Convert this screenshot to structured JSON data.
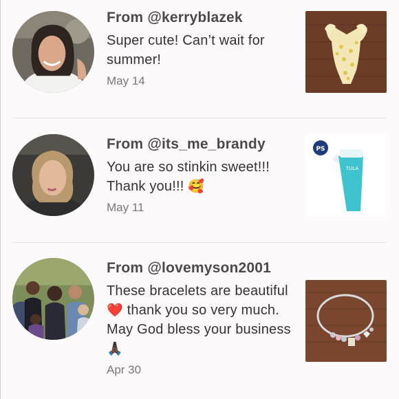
{
  "comments": [
    {
      "author": "From @kerryblazek",
      "body": "Super cute! Can’t wait for summer!",
      "date": "May 14",
      "avatar_icon": "avatar-woman-dark-hair",
      "thumb_icon": "yellow-swimsuit-product"
    },
    {
      "author": "From @its_me_brandy",
      "body": "You are so stinkin sweet!!! Thank you!!!",
      "emoji": "🥰",
      "date": "May 11",
      "avatar_icon": "avatar-woman-blonde",
      "thumb_icon": "tula-tube-product",
      "thumb_badge": "PS",
      "thumb_brand": "TULA"
    },
    {
      "author": "From @lovemyson2001",
      "body_part1": "These bracelets are beautiful",
      "heart": "❤️",
      "body_part2": "thank you so very much. May God bless your business",
      "pray": "🙏🏿",
      "date": "Apr 30",
      "avatar_icon": "avatar-family-group",
      "thumb_icon": "charm-bracelet-product"
    }
  ],
  "colors": {
    "background": "#fcfafb",
    "author": "#4a4a4a",
    "date": "#777777",
    "divider": "#e6e3e4"
  }
}
